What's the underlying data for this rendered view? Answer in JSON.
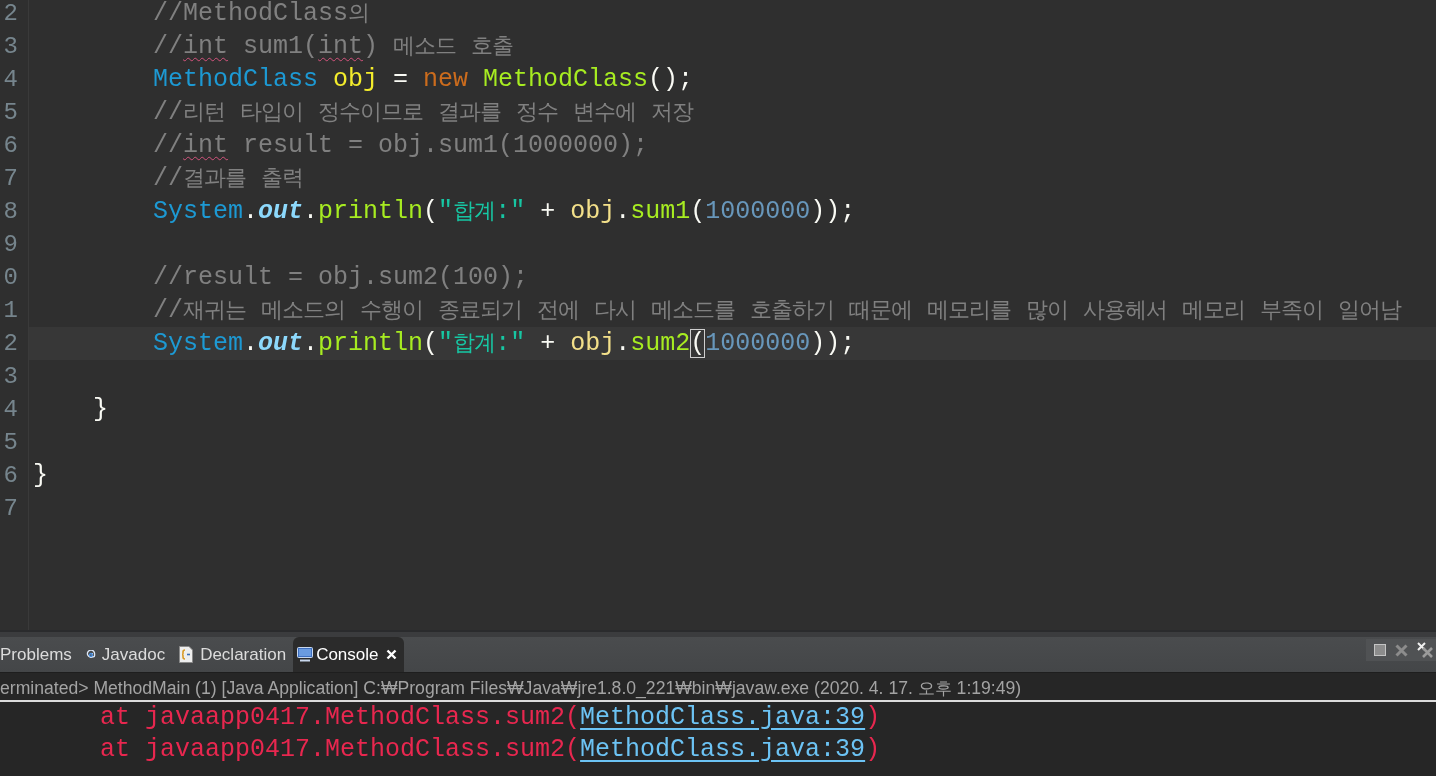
{
  "editor": {
    "lines": [
      {
        "children": [
          {
            "children": [
              {
                "number": "2",
                "current": false,
                "tokens": [
                  {
                    "text": "//MethodClass의",
                    "kind": "comment"
                  }
                ]
              },
              {
                "number": "3",
                "current": false,
                "tokens": [
                  {
                    "text": "//",
                    "kind": "comment"
                  },
                  {
                    "text": "int",
                    "kind": "comment_flagged"
                  },
                  {
                    "text": " sum1(",
                    "kind": "comment"
                  },
                  {
                    "text": "int",
                    "kind": "comment_flagged"
                  },
                  {
                    "text": ") 메소드 호출",
                    "kind": "comment"
                  }
                ]
              },
              {
                "number": "4",
                "current": false,
                "tokens": [
                  {
                    "text": "MethodClass ",
                    "kind": "type"
                  },
                  {
                    "text": "obj",
                    "kind": "variable_declaration"
                  },
                  {
                    "text": " = ",
                    "kind": "plain"
                  },
                  {
                    "text": "new ",
                    "kind": "keyword"
                  },
                  {
                    "text": "MethodClass",
                    "kind": "method"
                  },
                  {
                    "text": "();",
                    "kind": "plain"
                  }
                ]
              },
              {
                "number": "5",
                "current": false,
                "tokens": [
                  {
                    "text": "//리턴 타입이 정수이므로 결과를 정수 변수에 저장",
                    "kind": "comment"
                  }
                ]
              },
              {
                "number": "6",
                "current": false,
                "tokens": [
                  {
                    "text": "//",
                    "kind": "comment"
                  },
                  {
                    "text": "int",
                    "kind": "comment_flagged"
                  },
                  {
                    "text": " result = obj.sum1(1000000);",
                    "kind": "comment"
                  }
                ]
              },
              {
                "number": "7",
                "current": false,
                "tokens": [
                  {
                    "text": "//결과를 출력",
                    "kind": "comment"
                  }
                ]
              },
              {
                "number": "8",
                "current": false,
                "tokens": [
                  {
                    "text": "System",
                    "kind": "type"
                  },
                  {
                    "text": ".",
                    "kind": "plain"
                  },
                  {
                    "text": "out",
                    "kind": "static_field"
                  },
                  {
                    "text": ".",
                    "kind": "plain"
                  },
                  {
                    "text": "println",
                    "kind": "method"
                  },
                  {
                    "text": "(",
                    "kind": "plain"
                  },
                  {
                    "text": "\"합계:\"",
                    "kind": "string"
                  },
                  {
                    "text": " + ",
                    "kind": "plain"
                  },
                  {
                    "text": "obj",
                    "kind": "variable"
                  },
                  {
                    "text": ".",
                    "kind": "plain"
                  },
                  {
                    "text": "sum1",
                    "kind": "method"
                  },
                  {
                    "text": "(",
                    "kind": "plain"
                  },
                  {
                    "text": "1000000",
                    "kind": "number"
                  },
                  {
                    "text": "));",
                    "kind": "plain"
                  }
                ]
              },
              {
                "number": "9"
              },
              {
                "number": "0",
                "current": false,
                "tokens": [
                  {
                    "text": "//result = obj.sum2(100);",
                    "kind": "comment"
                  }
                ]
              },
              {
                "number": "1",
                "current": false,
                "tokens": [
                  {
                    "text": "//재귀는 메소드의 수행이 종료되기 전에 다시 메소드를 호출하기 때문에 메모리를 많이 사용헤서 메모리 부족이 일어남",
                    "kind": "comment"
                  }
                ]
              },
              {
                "number": "2",
                "current": true,
                "tokens": [
                  {
                    "text": "System",
                    "kind": "type"
                  },
                  {
                    "text": ".",
                    "kind": "plain"
                  },
                  {
                    "text": "out",
                    "kind": "static_field"
                  },
                  {
                    "text": ".",
                    "kind": "plain"
                  },
                  {
                    "text": "println",
                    "kind": "method"
                  },
                  {
                    "text": "(",
                    "kind": "plain"
                  },
                  {
                    "text": "\"합계:\"",
                    "kind": "string"
                  },
                  {
                    "text": " + ",
                    "kind": "plain"
                  },
                  {
                    "text": "obj",
                    "kind": "variable"
                  },
                  {
                    "text": ".",
                    "kind": "plain"
                  },
                  {
                    "text": "sum2",
                    "kind": "method"
                  },
                  {
                    "text": "(",
                    "kind": "bracket_match"
                  },
                  {
                    "text": "1000000",
                    "kind": "number"
                  },
                  {
                    "text": "));",
                    "kind": "plain"
                  }
                ]
              },
              {
                "number": "3"
              }
            ]
          },
          {
            "number": "4",
            "current": false,
            "tokens": [
              {
                "text": "}",
                "kind": "plain"
              }
            ]
          },
          {
            "number": "5"
          }
        ]
      },
      {
        "number": "6",
        "current": false,
        "tokens": [
          {
            "text": "}",
            "kind": "plain"
          }
        ]
      },
      {
        "number": "7"
      }
    ]
  },
  "panel": {
    "tabs": [
      {
        "label": "Problems",
        "kind": "problems",
        "selected": false
      },
      {
        "label": "Javadoc",
        "kind": "javadoc",
        "selected": false
      },
      {
        "label": "Declaration",
        "kind": "declaration",
        "selected": false
      },
      {
        "label": "Console",
        "kind": "console",
        "selected": true
      }
    ],
    "toolbar": [
      {
        "kind": "stop",
        "disabled": true
      },
      {
        "kind": "remove",
        "disabled": true
      },
      {
        "kind": "remove_all",
        "disabled": false
      }
    ]
  },
  "console": {
    "header": "erminated> MethodMain (1) [Java Application] C:₩Program Files₩Java₩jre1.8.0_221₩bin₩javaw.exe (2020. 4. 17. 오후 1:19:49)",
    "lines": [
      {
        "tokens": [
          {
            "text": "at javaapp0417.MethodClass.sum2(",
            "kind": "error"
          },
          {
            "text": "MethodClass.java:39",
            "kind": "link"
          },
          {
            "text": ")",
            "kind": "error"
          }
        ]
      },
      {
        "tokens": [
          {
            "text": "at javaapp0417.MethodClass.sum2(",
            "kind": "error"
          },
          {
            "text": "MethodClass.java:39",
            "kind": "link"
          },
          {
            "text": ")",
            "kind": "error"
          }
        ]
      }
    ]
  }
}
